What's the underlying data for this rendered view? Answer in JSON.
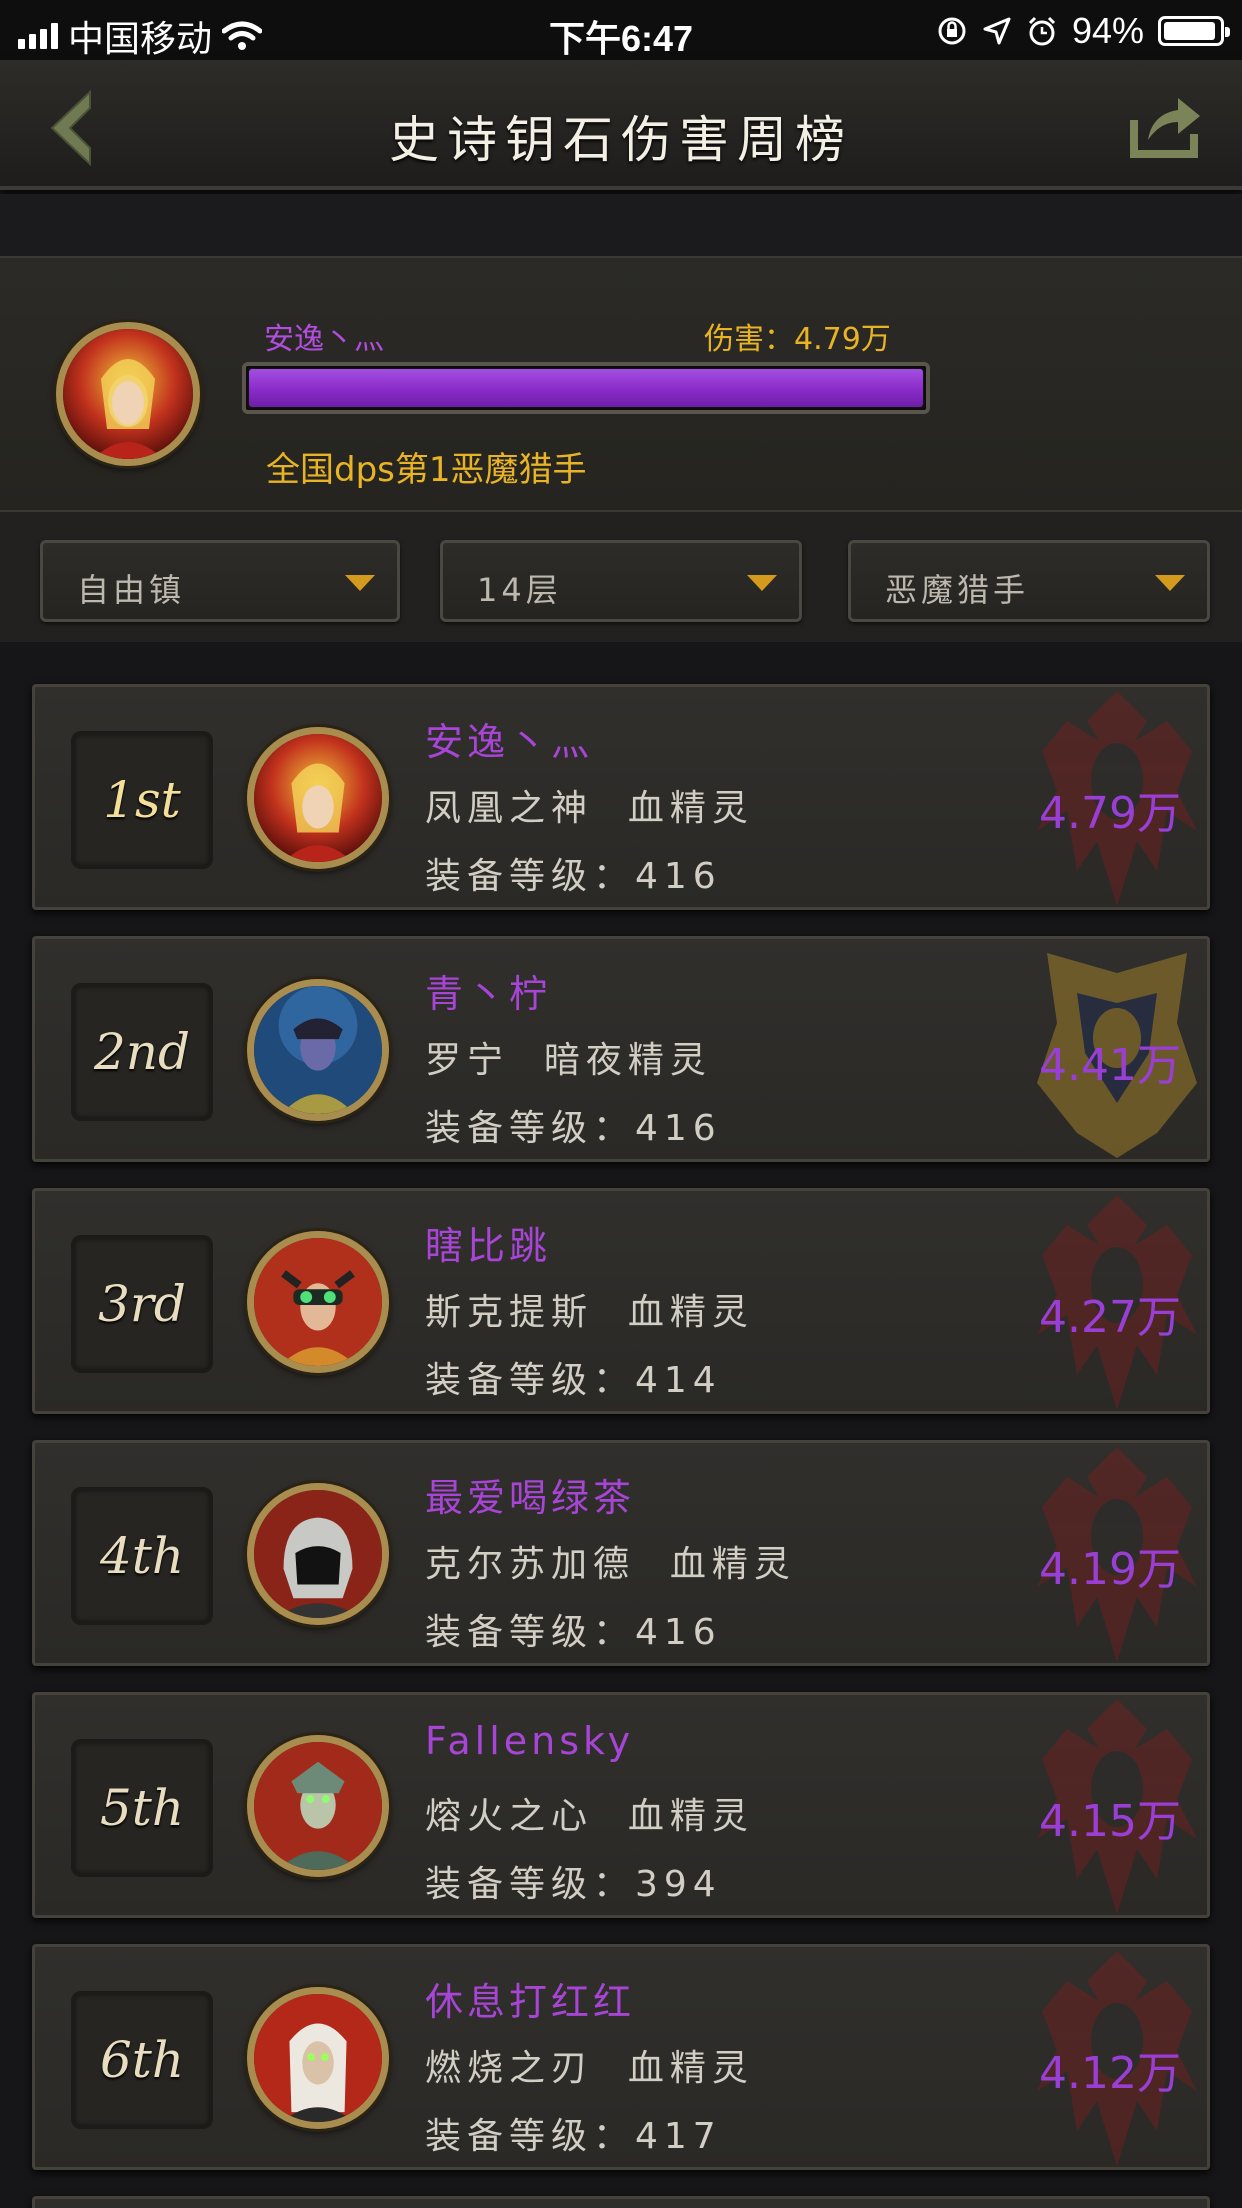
{
  "status_bar": {
    "carrier": "中国移动",
    "time": "下午6:47",
    "battery": "94%",
    "battery_level": 0.94
  },
  "nav": {
    "title": "史诗钥石伤害周榜",
    "back_icon": "chevron-left-icon",
    "share_icon": "share-icon"
  },
  "top_player": {
    "name": "安逸丶灬",
    "damage_label": "伤害：",
    "damage_value": "4.79万",
    "bar_fill": 1.0,
    "rank_text": "全国dps第1恶魔猎手"
  },
  "filters": [
    {
      "label": "自由镇"
    },
    {
      "label": "14层"
    },
    {
      "label": "恶魔猎手"
    }
  ],
  "rows": [
    {
      "rank": "1st",
      "name": "安逸丶灬",
      "subtitle": "凤凰之神  血精灵",
      "ilvl": "装备等级：416",
      "damage": "4.79万",
      "faction": "horde"
    },
    {
      "rank": "2nd",
      "name": "青丶柠",
      "subtitle": "罗宁  暗夜精灵",
      "ilvl": "装备等级：416",
      "damage": "4.41万",
      "faction": "alliance"
    },
    {
      "rank": "3rd",
      "name": "瞎比跳",
      "subtitle": "斯克提斯  血精灵",
      "ilvl": "装备等级：414",
      "damage": "4.27万",
      "faction": "horde"
    },
    {
      "rank": "4th",
      "name": "最爱喝绿茶",
      "subtitle": "克尔苏加德  血精灵",
      "ilvl": "装备等级：416",
      "damage": "4.19万",
      "faction": "horde"
    },
    {
      "rank": "5th",
      "name": "Fallensky",
      "subtitle": "熔火之心  血精灵",
      "ilvl": "装备等级：394",
      "damage": "4.15万",
      "faction": "horde"
    },
    {
      "rank": "6th",
      "name": "休息打红红",
      "subtitle": "燃烧之刃  血精灵",
      "ilvl": "装备等级：417",
      "damage": "4.12万",
      "faction": "horde"
    }
  ],
  "colors": {
    "name_purple": "#a845d6",
    "damage_purple": "#9a3fd6",
    "gold": "#e8b325",
    "horde_red": "#8a1d1d",
    "alliance_gold": "#b8902a"
  }
}
